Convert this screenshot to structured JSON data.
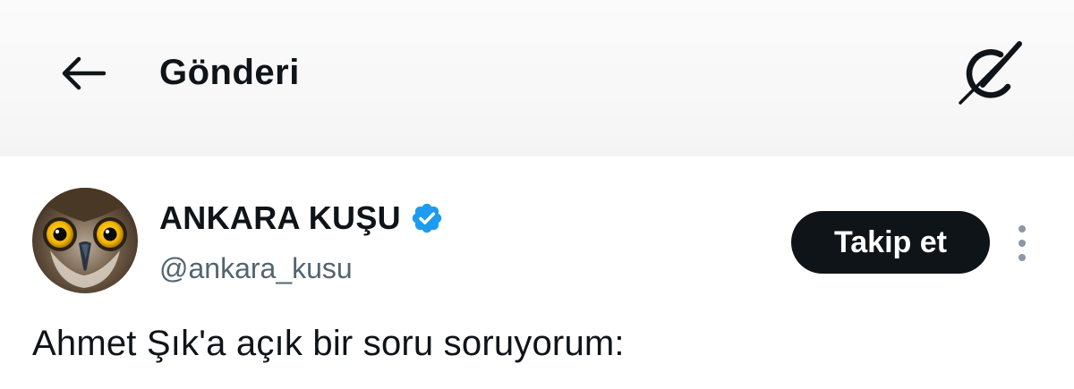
{
  "header": {
    "back_icon": "arrow-left-icon",
    "title": "Gönderi",
    "grok_icon": "grok-icon"
  },
  "post": {
    "author": {
      "display_name": "ANKARA KUŞU",
      "handle": "@ankara_kusu",
      "verified": true,
      "verified_icon": "verified-badge-icon",
      "avatar": "owl-avatar"
    },
    "follow_label": "Takip et",
    "more_icon": "more-vertical-icon",
    "text": "Ahmet Şık'a açık bir soru soruyorum:"
  },
  "colors": {
    "text": "#0f1419",
    "secondary_text": "#536471",
    "verified_blue": "#1d9bf0",
    "follow_bg": "#0f1419"
  }
}
